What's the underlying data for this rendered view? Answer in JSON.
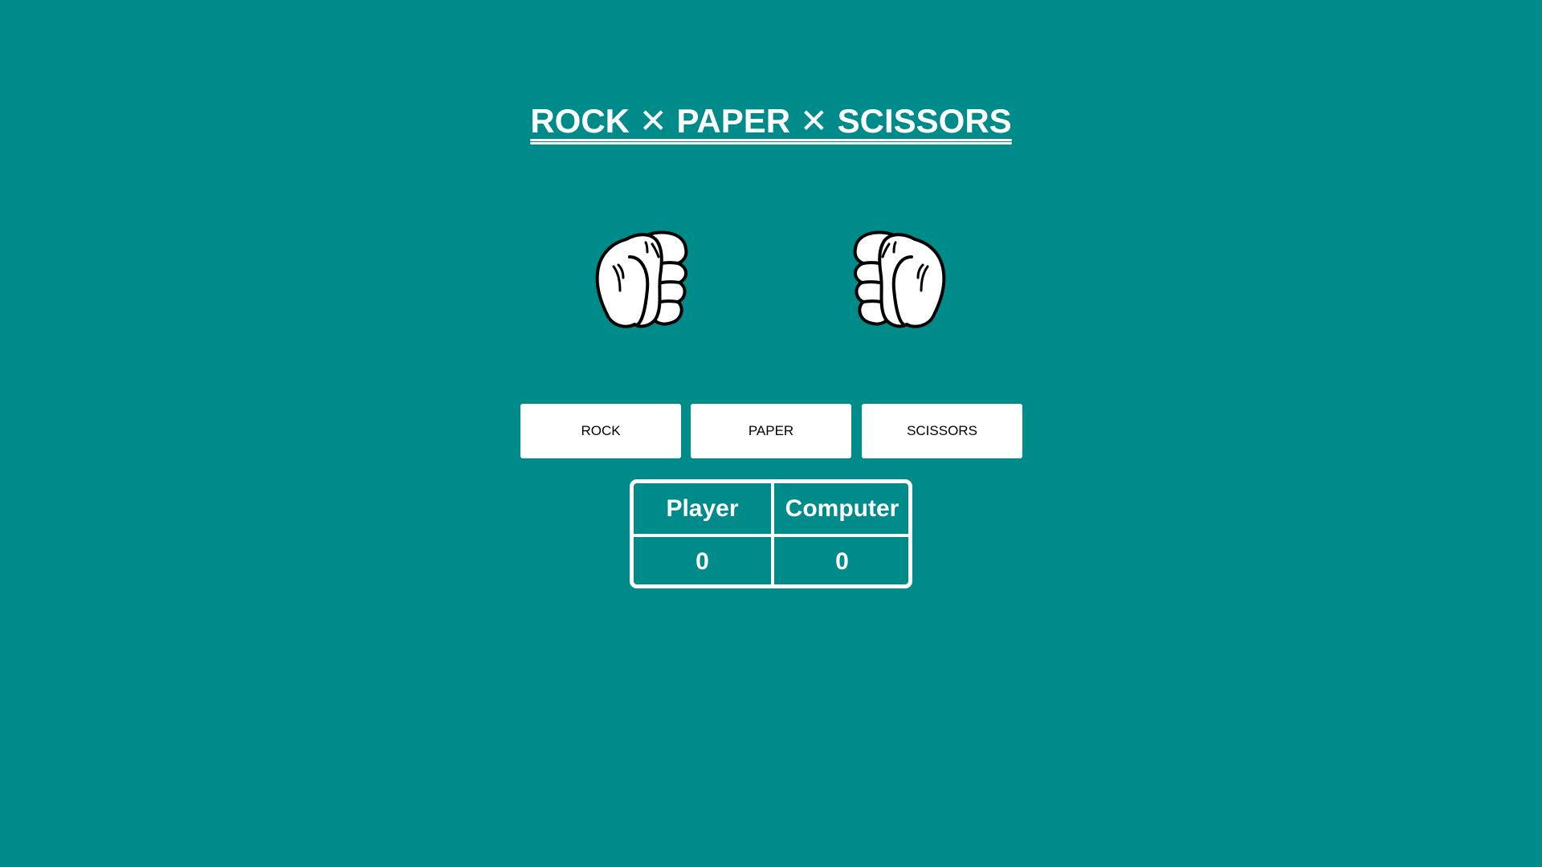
{
  "title": "ROCK ✕ PAPER ✕ SCISSORS",
  "colors": {
    "background": "#008b8b",
    "button_bg": "#ffffff",
    "text": "#ffffff"
  },
  "hands": {
    "player_icon": "fist-icon",
    "computer_icon": "fist-icon"
  },
  "buttons": {
    "rock_label": "ROCK",
    "paper_label": "PAPER",
    "scissors_label": "SCISSORS"
  },
  "scoreboard": {
    "player_header": "Player",
    "computer_header": "Computer",
    "player_score": "0",
    "computer_score": "0"
  }
}
